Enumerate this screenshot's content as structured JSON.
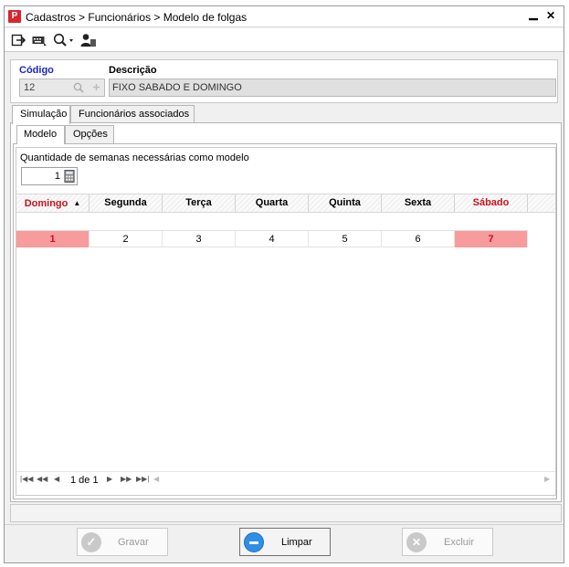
{
  "window": {
    "title": "Cadastros > Funcionários > Modelo de folgas",
    "icon_letter": "P",
    "pin_glyph": "▁",
    "close_glyph": "✕"
  },
  "toolbar": {
    "icons": [
      "exit-icon",
      "keyboard-icon",
      "search-dropdown-icon",
      "user-icon"
    ]
  },
  "form": {
    "codigo_label": "Código",
    "codigo_value": "12",
    "descricao_label": "Descrição",
    "descricao_value": "FIXO SABADO E DOMINGO"
  },
  "tabs_outer": [
    "Simulação",
    "Funcionários associados"
  ],
  "tabs_inner": [
    "Modelo",
    "Opções"
  ],
  "modelo": {
    "weeks_label": "Quantidade de semanas necessárias como modelo",
    "weeks_value": "1"
  },
  "grid": {
    "headers": [
      "Domingo",
      "Segunda",
      "Terça",
      "Quarta",
      "Quinta",
      "Sexta",
      "Sábado"
    ],
    "row": [
      "1",
      "2",
      "3",
      "4",
      "5",
      "6",
      "7"
    ],
    "highlight_color": "#f89b9d",
    "weekend_text_color": "#c8141c"
  },
  "pager": {
    "page_info": "1 de 1"
  },
  "buttons": {
    "gravar": "Gravar",
    "limpar": "Limpar",
    "excluir": "Excluir"
  }
}
